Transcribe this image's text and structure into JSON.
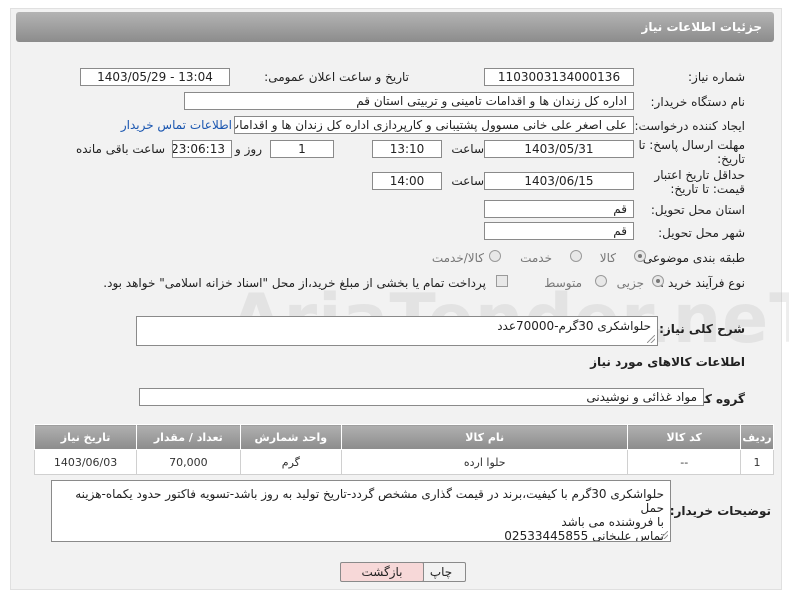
{
  "header": {
    "title": "جزئیات اطلاعات نیاز"
  },
  "fields": {
    "need_number": {
      "label": "شماره نیاز:",
      "value": "1103003134000136"
    },
    "announce": {
      "label": "تاریخ و ساعت اعلان عمومی:",
      "value": "1403/05/29 - 13:04"
    },
    "buyer_org": {
      "label": "نام دستگاه خریدار:",
      "value": "اداره کل زندان ها و اقدامات تامینی و تربیتی استان قم"
    },
    "requester": {
      "label": "ایجاد کننده درخواست:",
      "value": "علی اصغر علی خانی مسوول پشتیبانی و کارپردازی اداره کل زندان ها و اقدامات",
      "contact_link": "اطلاعات تماس خریدار"
    },
    "reply_deadline": {
      "label": "مهلت ارسال پاسخ: تا تاریخ:",
      "date": "1403/05/31",
      "time_label": "ساعت",
      "time": "13:10",
      "days": "1",
      "days_label": "روز و",
      "remaining": "23:06:13",
      "remaining_label": "ساعت باقی مانده"
    },
    "price_validity": {
      "label": "حداقل تاریخ اعتبار قیمت: تا تاریخ:",
      "date": "1403/06/15",
      "time_label": "ساعت",
      "time": "14:00"
    },
    "delivery_province": {
      "label": "استان محل تحویل:",
      "value": "قم"
    },
    "delivery_city": {
      "label": "شهر محل تحویل:",
      "value": "قم"
    },
    "category": {
      "label": "طبقه بندی موضوعی:",
      "options": [
        "کالا",
        "خدمت",
        "کالا/خدمت"
      ],
      "selected": "کالا"
    },
    "purchase_type": {
      "label": "نوع فرآیند خرید :",
      "options": [
        "جزیی",
        "متوسط"
      ],
      "note": "پرداخت تمام یا بخشی از مبلغ خرید،از محل \"اسناد خزانه اسلامی\" خواهد بود."
    }
  },
  "summary": {
    "label": "شرح کلی نیاز:",
    "value": "حلواشکری 30گرم-70000عدد"
  },
  "goods_section_title": "اطلاعات کالاهای مورد نیاز",
  "goods_group": {
    "label": "گروه کالا:",
    "value": "مواد غذائی و نوشیدنی"
  },
  "table": {
    "headers": [
      "ردیف",
      "کد کالا",
      "نام کالا",
      "واحد شمارش",
      "تعداد / مقدار",
      "تاریخ نیاز"
    ],
    "rows": [
      [
        "1",
        "--",
        "حلوا ارده",
        "گرم",
        "70,000",
        "1403/06/03"
      ]
    ]
  },
  "buyer_notes": {
    "label": "توضیحات خریدار:",
    "lines": [
      "حلواشکری 30گرم با کیفیت،برند در قیمت گذاری مشخص گردد-تاریخ تولید به روز باشد-تسویه فاکتور حدود یکماه-هزینه حمل",
      "با فروشنده می باشد",
      "تماس  علیخانی 02533445855"
    ]
  },
  "buttons": {
    "print": "چاپ",
    "back": "بازگشت"
  },
  "watermark": "AriaTender.neT",
  "colors": {
    "header": "#9a9a9a",
    "link": "#1a56b0",
    "back_button": "#f7d8d8"
  }
}
